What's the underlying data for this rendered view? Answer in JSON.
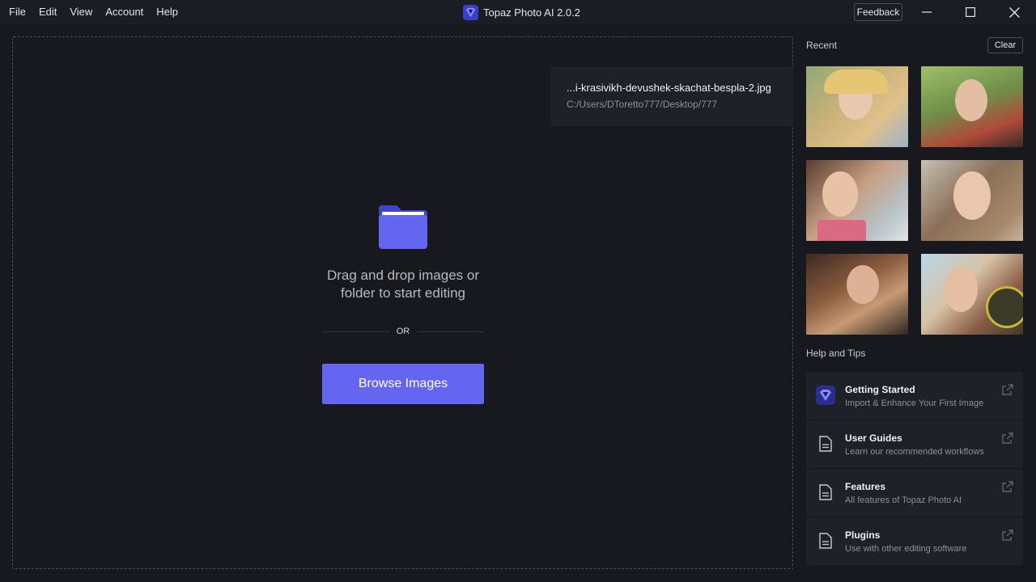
{
  "menu": [
    "File",
    "Edit",
    "View",
    "Account",
    "Help"
  ],
  "app": {
    "title": "Topaz Photo AI 2.0.2",
    "feedback_label": "Feedback",
    "accent": "#6466f1"
  },
  "recent_file": {
    "name": "...i-krasivikh-devushek-skachat-bespla-2.jpg",
    "path": "C:/Users/DToretto777/Desktop/777"
  },
  "dropzone": {
    "prompt": "Drag and drop images or folder to start editing",
    "or_label": "OR",
    "browse_label": "Browse Images"
  },
  "recent": {
    "heading": "Recent",
    "clear_label": "Clear",
    "thumbnails": [
      "recent-thumb-1",
      "recent-thumb-2",
      "recent-thumb-3",
      "recent-thumb-4",
      "recent-thumb-5",
      "recent-thumb-6"
    ]
  },
  "help": {
    "heading": "Help and Tips",
    "items": [
      {
        "title": "Getting Started",
        "subtitle": "Import & Enhance Your First Image",
        "icon": "topaz-logo-icon"
      },
      {
        "title": "User Guides",
        "subtitle": "Learn our recommended workflows",
        "icon": "document-icon"
      },
      {
        "title": "Features",
        "subtitle": "All features of Topaz Photo AI",
        "icon": "document-icon"
      },
      {
        "title": "Plugins",
        "subtitle": "Use with other editing software",
        "icon": "document-icon"
      }
    ]
  }
}
